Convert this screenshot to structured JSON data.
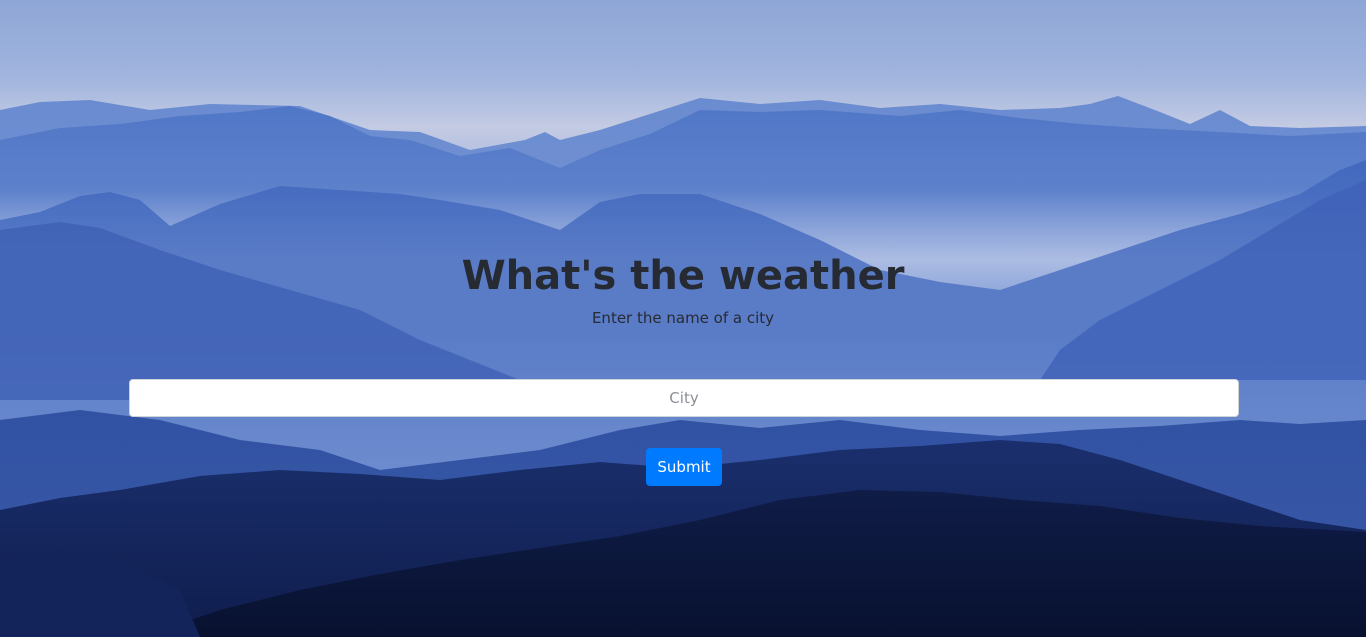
{
  "header": {
    "title": "What's the weather",
    "subtitle": "Enter the name of a city"
  },
  "form": {
    "city_placeholder": "City",
    "city_value": "",
    "submit_label": "Submit"
  },
  "colors": {
    "title_text": "#262a33",
    "submit_background": "#007bff",
    "submit_text": "#ffffff",
    "input_background": "#ffffff"
  }
}
